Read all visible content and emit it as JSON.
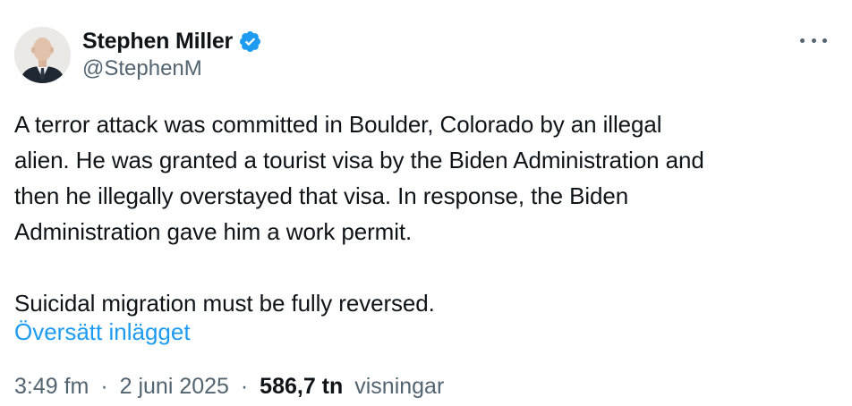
{
  "author": {
    "display_name": "Stephen Miller",
    "handle": "@StephenM",
    "verified": true,
    "verified_color": "#1d9bf0"
  },
  "tweet": {
    "lines": [
      "A terror attack was committed in Boulder, Colorado by an illegal",
      "alien. He was granted a tourist visa by the Biden Administration and",
      "then he illegally overstayed that visa. In response, the Biden",
      "Administration gave him a work permit."
    ],
    "second_paragraph": "Suicidal migration must be fully reversed.",
    "translate_label": "Översätt inlägget"
  },
  "meta": {
    "time": "3:49 fm",
    "separator": "·",
    "date": "2 juni 2025",
    "views_count": "586,7 tn",
    "views_label": "visningar"
  },
  "icons": {
    "more": "more-horizontal-icon",
    "verified": "verified-badge-icon"
  }
}
